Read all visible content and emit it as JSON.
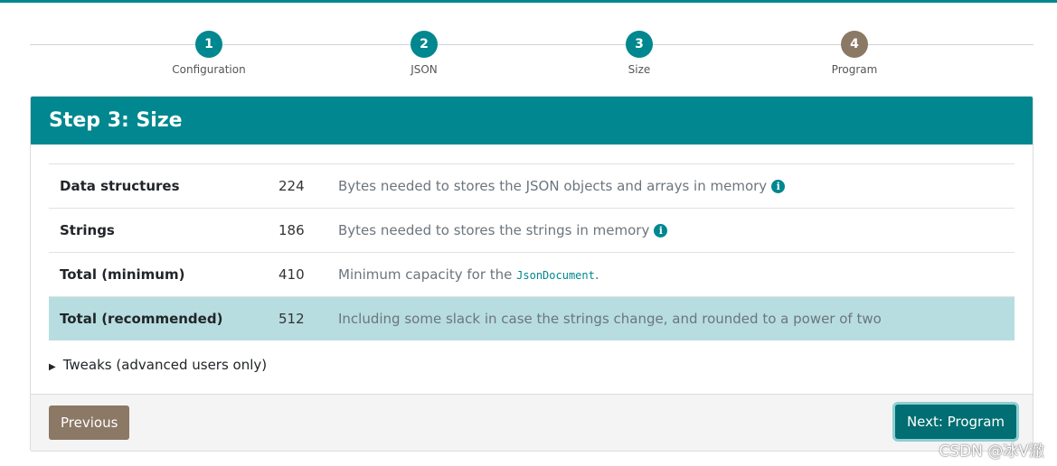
{
  "stepper": {
    "steps": [
      {
        "number": "1",
        "label": "Configuration",
        "state": "done"
      },
      {
        "number": "2",
        "label": "JSON",
        "state": "done"
      },
      {
        "number": "3",
        "label": "Size",
        "state": "current"
      },
      {
        "number": "4",
        "label": "Program",
        "state": "upcoming"
      }
    ]
  },
  "card": {
    "title": "Step 3: Size",
    "rows": [
      {
        "label": "Data structures",
        "value": "224",
        "description": "Bytes needed to stores the JSON objects and arrays in memory",
        "info_icon": "info-icon"
      },
      {
        "label": "Strings",
        "value": "186",
        "description": "Bytes needed to stores the strings in memory",
        "info_icon": "info-icon"
      },
      {
        "label": "Total (minimum)",
        "value": "410",
        "description_prefix": "Minimum capacity for the ",
        "description_code": "JsonDocument",
        "description_suffix": "."
      },
      {
        "label": "Total (recommended)",
        "value": "512",
        "description": "Including some slack in case the strings change, and rounded to a power of two"
      }
    ],
    "tweaks_label": "Tweaks (advanced users only)"
  },
  "footer": {
    "previous_label": "Previous",
    "next_label": "Next: Program"
  },
  "watermark": "CSDN @冰V澈",
  "colors": {
    "accent": "#00878f",
    "upcoming": "#8b7865",
    "highlight_row": "#b7dde0",
    "next_button": "#006e72"
  }
}
